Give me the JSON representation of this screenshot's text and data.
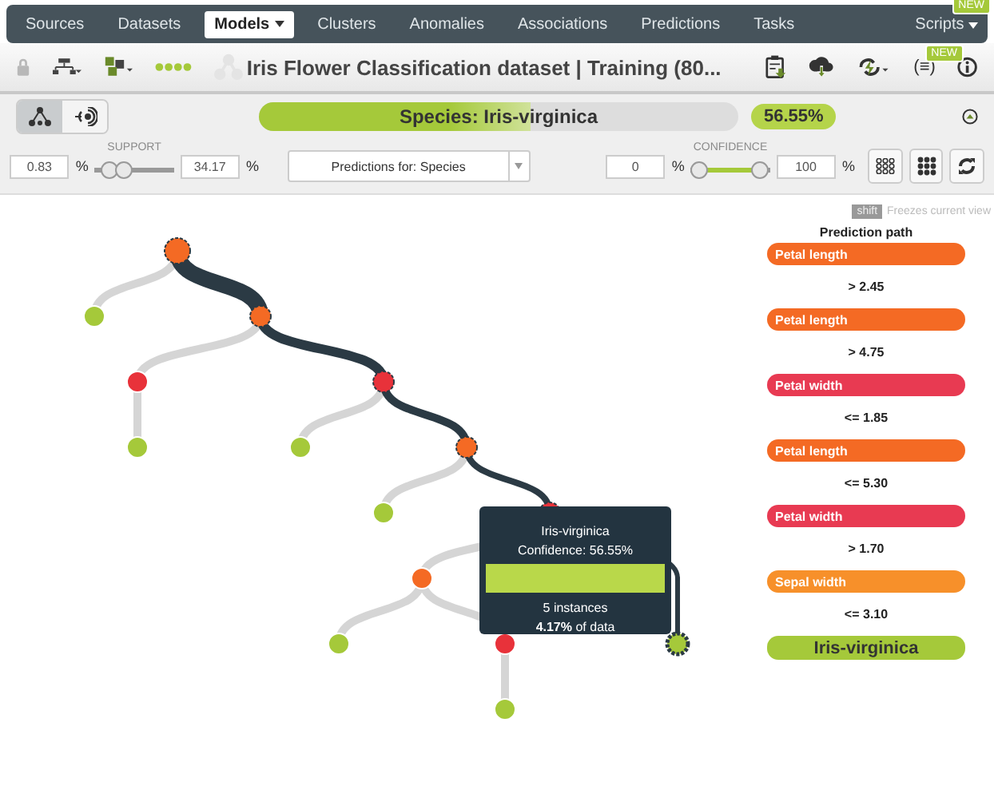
{
  "nav": {
    "tabs": [
      {
        "label": "Sources",
        "selected": false,
        "menu": false
      },
      {
        "label": "Datasets",
        "selected": false,
        "menu": false
      },
      {
        "label": "Models",
        "selected": true,
        "menu": true
      },
      {
        "label": "Clusters",
        "selected": false,
        "menu": false
      },
      {
        "label": "Anomalies",
        "selected": false,
        "menu": false
      },
      {
        "label": "Associations",
        "selected": false,
        "menu": false
      },
      {
        "label": "Predictions",
        "selected": false,
        "menu": false
      },
      {
        "label": "Tasks",
        "selected": false,
        "menu": false
      }
    ],
    "scripts": {
      "label": "Scripts",
      "badge": "NEW"
    }
  },
  "toolbar": {
    "title": "Iris Flower Classification dataset | Training (80...",
    "formula_badge": "NEW",
    "formula_label": "(≡)"
  },
  "prediction": {
    "label": "Species: Iris-virginica",
    "level": 0.5655,
    "confidence": "56.55%"
  },
  "view_toggles": [
    {
      "kind": "tree",
      "selected": true
    },
    {
      "kind": "sunburst",
      "selected": false
    }
  ],
  "support": {
    "label": "SUPPORT",
    "min": "0.83",
    "max": "34.17",
    "unit": "%",
    "thumbs": [
      {
        "level": 0.1
      },
      {
        "level": 0.35
      }
    ]
  },
  "target": {
    "value": "Predictions for: Species"
  },
  "confidence": {
    "label": "CONFIDENCE",
    "min": "0",
    "max": "100",
    "unit": "%",
    "thumbs": [
      {
        "level": 0
      },
      {
        "level": 1
      }
    ]
  },
  "freeze": {
    "key": "shift",
    "text": "Freezes current view"
  },
  "path": {
    "title": "Prediction path",
    "items": [
      {
        "kind": "field",
        "text": "Petal length",
        "color": "#f46a24"
      },
      {
        "kind": "condition",
        "text": "> 2.45"
      },
      {
        "kind": "field",
        "text": "Petal length",
        "color": "#f46a24"
      },
      {
        "kind": "condition",
        "text": "> 4.75"
      },
      {
        "kind": "field",
        "text": "Petal width",
        "color": "#e83a52"
      },
      {
        "kind": "condition",
        "text": "<= 1.85"
      },
      {
        "kind": "field",
        "text": "Petal length",
        "color": "#f46a24"
      },
      {
        "kind": "condition",
        "text": "<= 5.30"
      },
      {
        "kind": "field",
        "text": "Petal width",
        "color": "#e83a52"
      },
      {
        "kind": "condition",
        "text": "> 1.70"
      },
      {
        "kind": "field",
        "text": "Sepal width",
        "color": "#f7902a"
      },
      {
        "kind": "condition",
        "text": "<= 3.10"
      },
      {
        "kind": "result",
        "text": "Iris-virginica",
        "color": "#a5c93a"
      }
    ]
  },
  "tree": {
    "color": "#f46a24",
    "on_path": true,
    "selected": false,
    "children": [
      {
        "color": "#a5c93a",
        "on_path": false,
        "selected": false
      },
      {
        "color": "#f46a24",
        "on_path": true,
        "selected": false,
        "children": [
          {
            "color": "#e8323a",
            "on_path": false,
            "selected": false,
            "children": [
              {
                "color": "#a5c93a",
                "on_path": false,
                "selected": false
              }
            ]
          },
          {
            "color": "#e8323a",
            "on_path": true,
            "selected": false,
            "children": [
              {
                "color": "#a5c93a",
                "on_path": false,
                "selected": false
              },
              {
                "color": "#f46a24",
                "on_path": true,
                "selected": false,
                "children": [
                  {
                    "color": "#a5c93a",
                    "on_path": false,
                    "selected": false
                  },
                  {
                    "color": "#e8323a",
                    "on_path": true,
                    "selected": false,
                    "children": [
                      {
                        "color": "#f46a24",
                        "on_path": false,
                        "selected": false,
                        "children": [
                          {
                            "color": "#a5c93a",
                            "on_path": false,
                            "selected": false
                          },
                          {
                            "color": "#e8323a",
                            "on_path": false,
                            "selected": false,
                            "children": [
                              {
                                "color": "#a5c93a",
                                "on_path": false,
                                "selected": false
                              }
                            ]
                          }
                        ]
                      },
                      {
                        "on_path": true,
                        "children": [
                          {
                            "color": "#a5c93a",
                            "on_path": true,
                            "selected": true
                          }
                        ]
                      }
                    ]
                  }
                ]
              }
            ]
          }
        ]
      }
    ]
  },
  "tooltip": {
    "title": "Iris-virginica",
    "confidence": "Confidence: 56.55%",
    "instances": "5 instances",
    "share": "**4.17%** of data"
  }
}
